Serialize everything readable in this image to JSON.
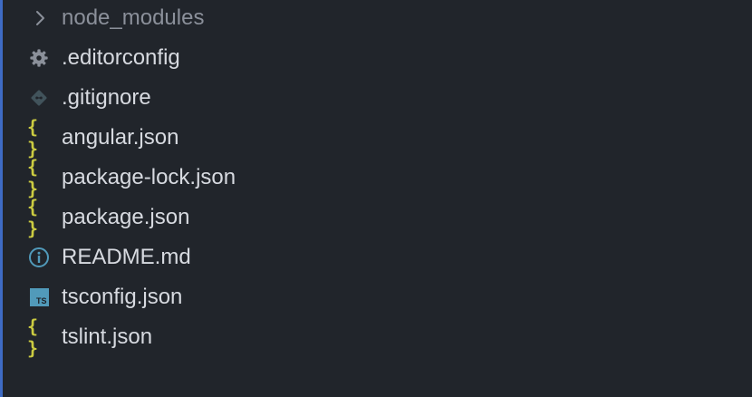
{
  "colors": {
    "background": "#21252b",
    "focus_edge": "#3e6bc4",
    "text": "#d7dae0",
    "folder_text": "#8b909a",
    "json_icon": "#cbcb41",
    "ts_icon": "#519aba",
    "settings_icon": "#8b909a",
    "git_icon": "#41535b",
    "info_icon": "#519aba"
  },
  "tree": {
    "items": [
      {
        "label": "node_modules",
        "icon": "chevron-right-icon",
        "kind": "folder"
      },
      {
        "label": ".editorconfig",
        "icon": "gear-icon",
        "kind": "file"
      },
      {
        "label": ".gitignore",
        "icon": "git-icon",
        "kind": "file"
      },
      {
        "label": "angular.json",
        "icon": "json-braces-icon",
        "icon_text": "{ }",
        "kind": "file"
      },
      {
        "label": "package-lock.json",
        "icon": "json-braces-icon",
        "icon_text": "{ }",
        "kind": "file"
      },
      {
        "label": "package.json",
        "icon": "json-braces-icon",
        "icon_text": "{ }",
        "kind": "file"
      },
      {
        "label": "README.md",
        "icon": "info-icon",
        "kind": "file"
      },
      {
        "label": "tsconfig.json",
        "icon": "typescript-icon",
        "icon_text": "TS",
        "kind": "file"
      },
      {
        "label": "tslint.json",
        "icon": "json-braces-icon",
        "icon_text": "{ }",
        "kind": "file"
      }
    ]
  }
}
